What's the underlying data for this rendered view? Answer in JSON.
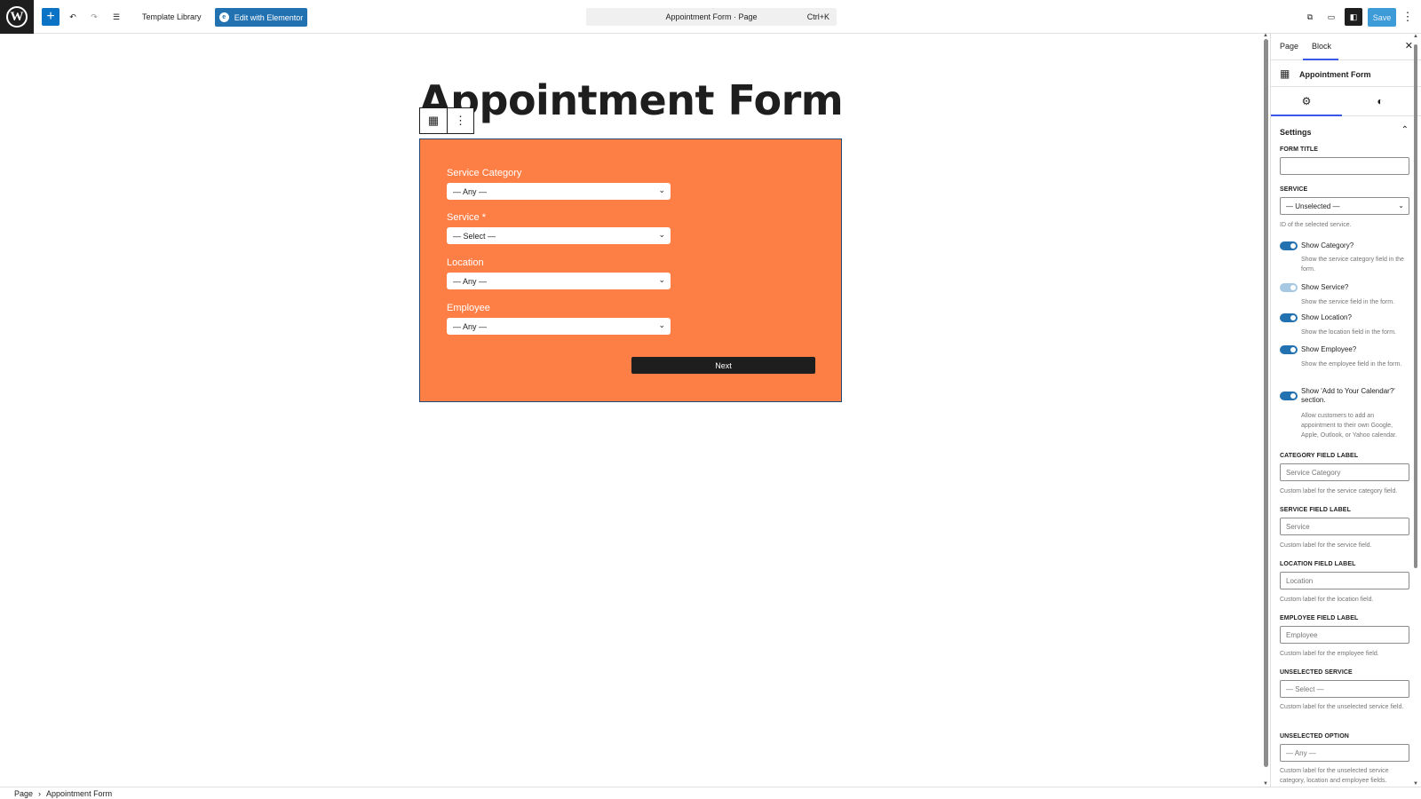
{
  "topbar": {
    "add_label": "+",
    "undo_icon": "↶",
    "redo_icon": "↷",
    "listview_icon": "☰",
    "template_library": "Template Library",
    "elementor_icon_label": "e",
    "elementor_label": "Edit with Elementor",
    "command_title": "Appointment Form · Page",
    "command_shortcut": "Ctrl+K",
    "view_icon": "⧉",
    "preview_icon": "▭",
    "settings_icon": "◧",
    "save_label": "Save",
    "options_icon": "⋮"
  },
  "canvas": {
    "heading": "Appointment Form",
    "block_icon": "▦",
    "block_more_icon": "⋮",
    "form": {
      "bg_color": "#fe7f46",
      "fields": [
        {
          "label": "Service Category",
          "value": "— Any —"
        },
        {
          "label": "Service",
          "required_mark": "*",
          "value": "— Select —"
        },
        {
          "label": "Location",
          "value": "— Any —"
        },
        {
          "label": "Employee",
          "value": "— Any —"
        }
      ],
      "chevron": "⌄",
      "next_label": "Next"
    }
  },
  "footer": {
    "crumbs": [
      "Page",
      "Appointment Form"
    ],
    "separator": "›"
  },
  "sidebar": {
    "tab_page": "Page",
    "tab_block": "Block",
    "close_icon": "✕",
    "block_icon": "▦",
    "block_title": "Appointment Form",
    "gear_icon": "⚙",
    "style_icon": "◐",
    "panel_title": "Settings",
    "panel_chevron": "⌃",
    "form_title_label": "Form title",
    "form_title_value": "",
    "service_label": "Service",
    "service_value": "— Unselected —",
    "service_help": "ID of the selected service.",
    "toggles": [
      {
        "label": "Show Category?",
        "help": "Show the service category field in the form.",
        "on": true
      },
      {
        "label": "Show Service?",
        "help": "Show the service field in the form.",
        "on": true,
        "disabled": true
      },
      {
        "label": "Show Location?",
        "help": "Show the location field in the form.",
        "on": true
      },
      {
        "label": "Show Employee?",
        "help": "Show the employee field in the form.",
        "on": true
      },
      {
        "label": "Show 'Add to Your Calendar?' section.",
        "help": "Allow customers to add an appointment to their own Google, Apple, Outlook, or Yahoo calendar.",
        "on": true
      }
    ],
    "category_field_label": "Category field label",
    "category_field_placeholder": "Service Category",
    "category_field_help": "Custom label for the service category field.",
    "service_field_label": "Service field label",
    "service_field_placeholder": "Service",
    "service_field_help": "Custom label for the service field.",
    "location_field_label": "Location field label",
    "location_field_placeholder": "Location",
    "location_field_help": "Custom label for the location field.",
    "employee_field_label": "Employee field label",
    "employee_field_placeholder": "Employee",
    "employee_field_help": "Custom label for the employee field.",
    "unselected_service_label": "Unselected service",
    "unselected_service_placeholder": "— Select —",
    "unselected_service_help": "Custom label for the unselected service field.",
    "unselected_option_label": "Unselected option",
    "unselected_option_placeholder": "— Any —",
    "unselected_option_help": "Custom label for the unselected service category, location and employee fields."
  },
  "scroll": {
    "up": "▲",
    "down": "▼"
  }
}
